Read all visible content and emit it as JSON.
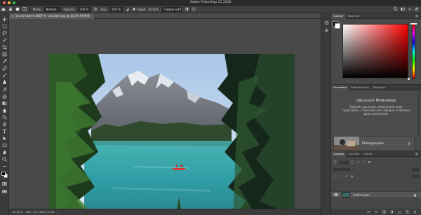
{
  "app": {
    "title": "Adobe Photoshop CC 2018"
  },
  "options_bar": {
    "mode_label": "Mode :",
    "mode_value": "Normal",
    "opacity_label": "Opacité :",
    "opacity_value": "100 %",
    "flow_label": "Flux :",
    "flow_value": "100 %",
    "align_label": "Aligné",
    "sample_label": "Échant. :",
    "sample_value": "Calque actif"
  },
  "document": {
    "tab_title": "bruno-soares-284974- unsplash.jpg @ 33,3% (RVB/8)",
    "zoom": "33,33 %",
    "doc_info": "Doc : 17,1 Mo/17,1 Mo"
  },
  "color_panel": {
    "tabs": [
      "Couleur",
      "Nuancier"
    ],
    "foreground": "#000000",
    "background": "#ffffff",
    "picker_hue": "#ff0000"
  },
  "learn_panel": {
    "tabs": [
      "Formation",
      "Bibliothèques",
      "Réglages"
    ],
    "heading": "Découvrir Photoshop",
    "description": "Tutoriels pas à pas, directement dans l'application. Choisissez une rubrique ci-dessous pour commencer.",
    "cards": [
      {
        "label": "Photographie"
      },
      {
        "label": "Retouche"
      }
    ]
  },
  "layers_panel": {
    "tabs": [
      "Calques",
      "Couches",
      "Tracés"
    ],
    "layers": [
      {
        "name": "Arrière-plan",
        "visible": true,
        "locked": true
      }
    ]
  },
  "colors": {
    "accent": "#2d8ceb",
    "panel_bg": "#474747"
  }
}
